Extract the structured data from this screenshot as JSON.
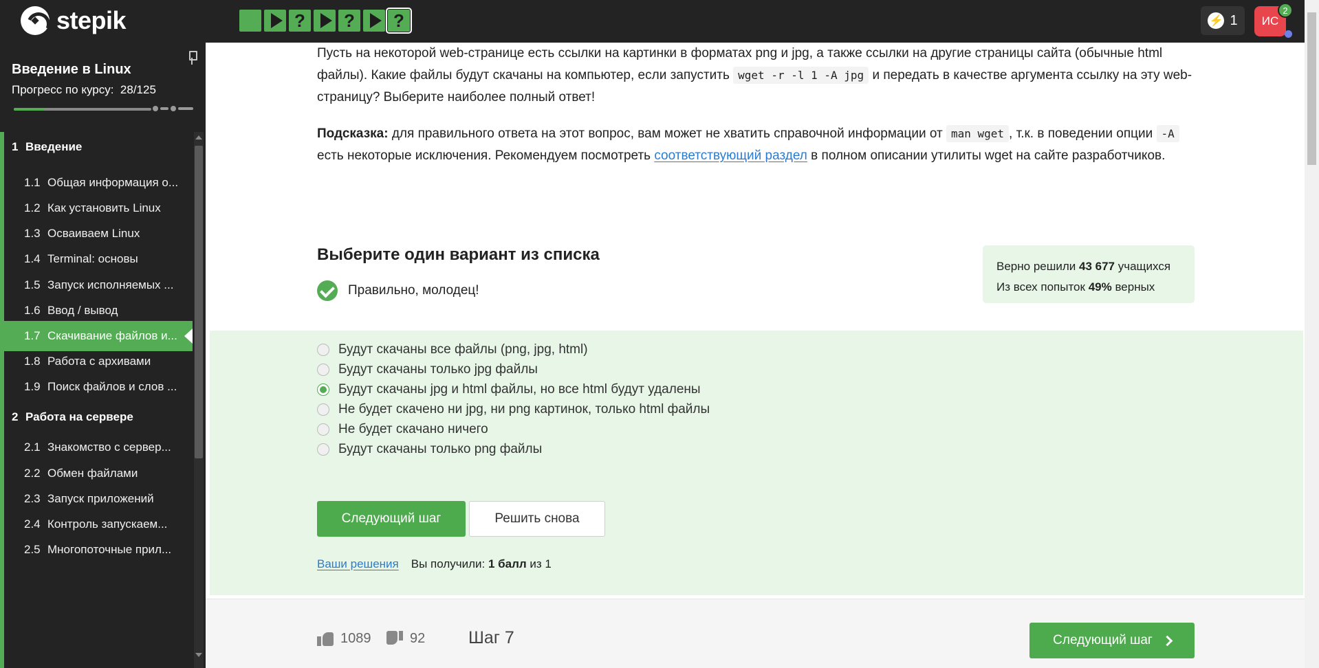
{
  "header": {
    "logo_text": "stepik",
    "step_icons": [
      "square",
      "play",
      "question",
      "play",
      "question",
      "play",
      "question"
    ],
    "step_question_glyph": "?",
    "energy_count": "1",
    "avatar_initials": "ИС",
    "notification_count": "2",
    "colors": {
      "bg": "#232323",
      "accent": "#54ad54",
      "avatar": "#e8464c"
    }
  },
  "sidebar": {
    "course_title": "Введение в Linux",
    "progress_label": "Прогресс по курсу:",
    "progress_value": "28/125",
    "progress_fraction": 0.224,
    "sections": [
      {
        "num": "1",
        "title": "Введение"
      },
      {
        "num": "2",
        "title": "Работа на сервере"
      }
    ],
    "items": [
      {
        "num": "1.1",
        "label": "Общая информация о..."
      },
      {
        "num": "1.2",
        "label": "Как установить Linux"
      },
      {
        "num": "1.3",
        "label": "Осваиваем Linux"
      },
      {
        "num": "1.4",
        "label": "Terminal: основы"
      },
      {
        "num": "1.5",
        "label": "Запуск исполняемых ..."
      },
      {
        "num": "1.6",
        "label": "Ввод / вывод"
      },
      {
        "num": "1.7",
        "label": "Скачивание файлов и..."
      },
      {
        "num": "1.8",
        "label": "Работа с архивами"
      },
      {
        "num": "1.9",
        "label": "Поиск файлов и слов ..."
      },
      {
        "num": "2.1",
        "label": "Знакомство с сервер..."
      },
      {
        "num": "2.2",
        "label": "Обмен файлами"
      },
      {
        "num": "2.3",
        "label": "Запуск приложений"
      },
      {
        "num": "2.4",
        "label": "Контроль запускаем..."
      },
      {
        "num": "2.5",
        "label": "Многопоточные прил..."
      }
    ],
    "active_item": "1.7"
  },
  "question": {
    "p1_a": "Пусть на некоторой web-странице есть ссылки на картинки в форматах png и jpg, а также ссылки на другие страницы сайта (обычные html файлы). Какие файлы будут скачаны на компьютер, если запустить ",
    "p1_code": "wget -r -l 1 -A jpg",
    "p1_b": " и передать в качестве аргумента ссылку на эту web-страницу? Выберите наиболее полный ответ!",
    "hint_label": "Подсказка:",
    "hint_a": " для правильного ответа на этот вопрос, вам может не хватить справочной информации от ",
    "hint_code1": "man wget",
    "hint_b": ", т.к. в поведении опции ",
    "hint_code2": "-A",
    "hint_c": " есть некоторые исключения. Рекомендуем посмотреть ",
    "hint_link": "соответствующий раздел",
    "hint_d": " в полном описании утилиты wget на сайте разработчиков."
  },
  "quiz": {
    "title": "Выберите один вариант из списка",
    "correct_message": "Правильно, молодец!",
    "stats": {
      "line1_a": "Верно решили ",
      "line1_value": "43 677",
      "line1_b": " учащихся",
      "line2_a": "Из всех попыток ",
      "line2_value": "49%",
      "line2_b": " верных"
    },
    "options": [
      {
        "label": "Будут скачаны все файлы (png, jpg, html)",
        "checked": false
      },
      {
        "label": "Будут скачаны только jpg файлы",
        "checked": false
      },
      {
        "label": "Будут скачаны jpg и html файлы, но все html будут удалены",
        "checked": true
      },
      {
        "label": "Не будет скачено ни jpg, ни png картинок, только html файлы",
        "checked": false
      },
      {
        "label": "Не будет скачано ничего",
        "checked": false
      },
      {
        "label": "Будут скачаны только png файлы",
        "checked": false
      }
    ],
    "next_button": "Следующий шаг",
    "retry_button": "Решить снова",
    "solutions_link": "Ваши решения",
    "score_a": "Вы получили: ",
    "score_value": "1 балл",
    "score_b": " из 1"
  },
  "footer": {
    "likes": "1089",
    "dislikes": "92",
    "step_label": "Шаг 7",
    "next_button": "Следующий шаг"
  }
}
